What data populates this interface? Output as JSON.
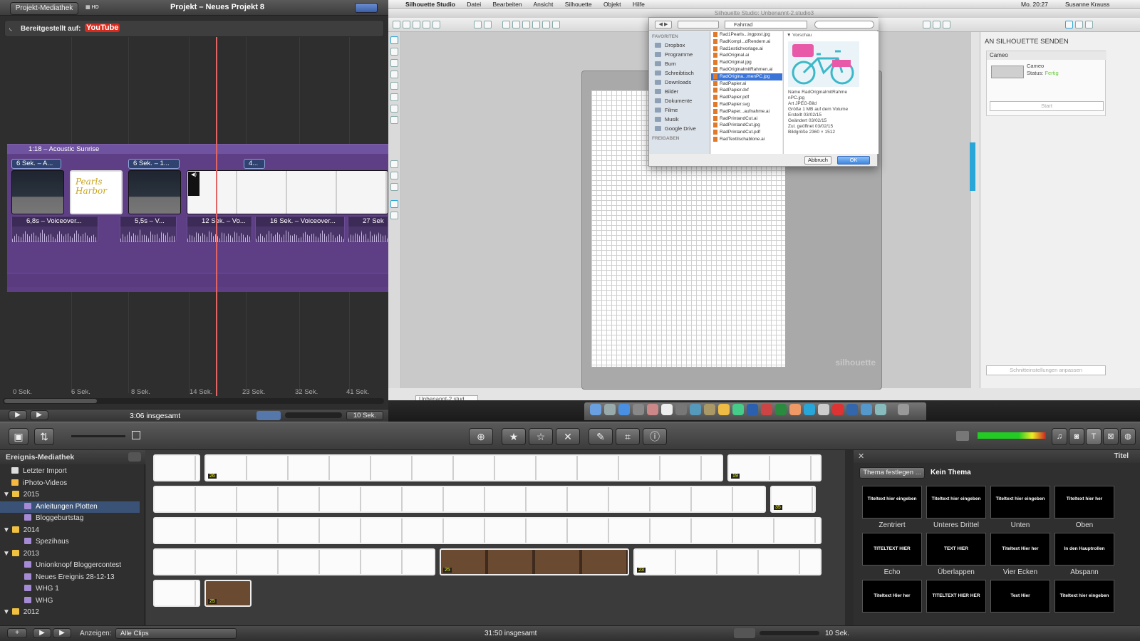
{
  "project": {
    "library_button": "Projekt-Mediathek",
    "title": "Projekt – Neues Projekt 8",
    "shared_label": "Bereitgestellt auf:",
    "shared_service": "YouTube",
    "music_track": "1:18 – Acoustic Sunrise",
    "clip_tags": [
      "6 Sek. – A...",
      "6 Sek. – 1...",
      "4..."
    ],
    "voice_clips": [
      "6,8s – Voiceover...",
      "5,5s – V...",
      "12 Sek. – Vo...",
      "16 Sek. – Voiceover...",
      "27 Sek"
    ],
    "pearl_text": "Pearls Harbor",
    "ruler": [
      "0 Sek.",
      "6 Sek.",
      "8 Sek.",
      "14 Sek.",
      "23 Sek.",
      "32 Sek.",
      "41 Sek."
    ],
    "total": "3:06 insgesamt",
    "zoom": "10 Sek."
  },
  "mac_menu": [
    "Silhouette Studio",
    "Datei",
    "Bearbeiten",
    "Ansicht",
    "Silhouette",
    "Objekt",
    "Hilfe"
  ],
  "mac_status": {
    "clock": "Mo. 20:27",
    "user": "Susanne Krauss"
  },
  "silhouette": {
    "window_title": "Silhouette Studio: Unbenannt-2.studio3",
    "doc_tab": "Unbenannt-2.stud...",
    "mat_logo": "silhouette",
    "send_title": "AN SILHOUETTE SENDEN",
    "device": "Cameo",
    "device_name": "Cameo",
    "status_label": "Status:",
    "status_value": "Fertig",
    "start_button": "Start",
    "cut_settings_button": "Schnitteinstellungen anpassen"
  },
  "dialog": {
    "folder": "Fahrrad",
    "favorites_header": "FAVORITEN",
    "favorites": [
      "Dropbox",
      "Programme",
      "Burn",
      "Schreibtisch",
      "Downloads",
      "Bilder",
      "Dokumente",
      "Filme",
      "Musik",
      "Google Drive"
    ],
    "shared_header": "FREIGABEN",
    "files": [
      "Rad1Pearls...ingpost.jpg",
      "RadKompl...dRendern.ai",
      "Rad1estichvorlage.ai",
      "RadOriginal.ai",
      "RadOriginal.jpg",
      "RadOriginalmitRahmen.ai",
      "RadOrigina...menPC.jpg",
      "RadPapier.ai",
      "RadPapier.dxf",
      "RadPapier.pdf",
      "RadPapier.svg",
      "RadPaper...aufnahme.ai",
      "RadPrintandCut.ai",
      "RadPrintandCut.jpg",
      "RadPrintandCut.pdf",
      "RadTextilschablone.ai"
    ],
    "selected_index": 6,
    "preview_header": "▼ Vorschau",
    "meta": [
      "Name RadOriginalmitRahme",
      "nPC.jpg",
      "Art JPEG-Bild",
      "Größe 1 MB auf dem Volume",
      "Erstellt 03/02/15",
      "Geändert 03/02/15",
      "Zul. geöffnet 03/02/15",
      "Bildgröße 2360 × 1512"
    ],
    "cancel": "Abbruch",
    "ok": "OK"
  },
  "events": {
    "header": "Ereignis-Mediathek",
    "items": [
      {
        "label": "Letzter Import",
        "level": 1,
        "type": "import"
      },
      {
        "label": "iPhoto-Videos",
        "level": 1,
        "type": "iphoto"
      },
      {
        "label": "2015",
        "level": 0,
        "type": "year"
      },
      {
        "label": "Anleitungen Plotten",
        "level": 2,
        "type": "event",
        "selected": true
      },
      {
        "label": "Bloggeburtstag",
        "level": 2,
        "type": "event"
      },
      {
        "label": "2014",
        "level": 0,
        "type": "year"
      },
      {
        "label": "Spezihaus",
        "level": 2,
        "type": "event"
      },
      {
        "label": "2013",
        "level": 0,
        "type": "year"
      },
      {
        "label": "Unionknopf Bloggercontest",
        "level": 2,
        "type": "event"
      },
      {
        "label": "Neues Ereignis 28-12-13",
        "level": 2,
        "type": "event"
      },
      {
        "label": "WHG 1",
        "level": 2,
        "type": "event"
      },
      {
        "label": "WHG",
        "level": 2,
        "type": "event"
      },
      {
        "label": "2012",
        "level": 0,
        "type": "year"
      }
    ]
  },
  "clip_badges": [
    "26",
    "19",
    "35",
    "25",
    "23",
    "25"
  ],
  "titles": {
    "header": "Titel",
    "theme_button": "Thema festlegen ...",
    "theme_value": "Kein Thema",
    "items": [
      {
        "label": "Zentriert",
        "preview": "Titeltext hier eingeben"
      },
      {
        "label": "Unteres Drittel",
        "preview": "Titeltext hier eingeben"
      },
      {
        "label": "Unten",
        "preview": "Titeltext hier eingeben"
      },
      {
        "label": "Oben",
        "preview": "Titeltext hier her"
      },
      {
        "label": "Echo",
        "preview": "TITELTEXT HIER"
      },
      {
        "label": "Überlappen",
        "preview": "TEXT HIER"
      },
      {
        "label": "Vier Ecken",
        "preview": "Titeltext Hier her"
      },
      {
        "label": "Abspann",
        "preview": "In den Hauptrollen"
      },
      {
        "label": "",
        "preview": "Titeltext Hier her"
      },
      {
        "label": "",
        "preview": "TITELTEXT HIER HER"
      },
      {
        "label": "",
        "preview": "Text Hier"
      },
      {
        "label": "",
        "preview": "Titeltext hier eingeben"
      }
    ]
  },
  "bottom": {
    "show_label": "Anzeigen:",
    "show_value": "Alle Clips",
    "total": "31:50 insgesamt",
    "zoom": "10 Sek."
  }
}
